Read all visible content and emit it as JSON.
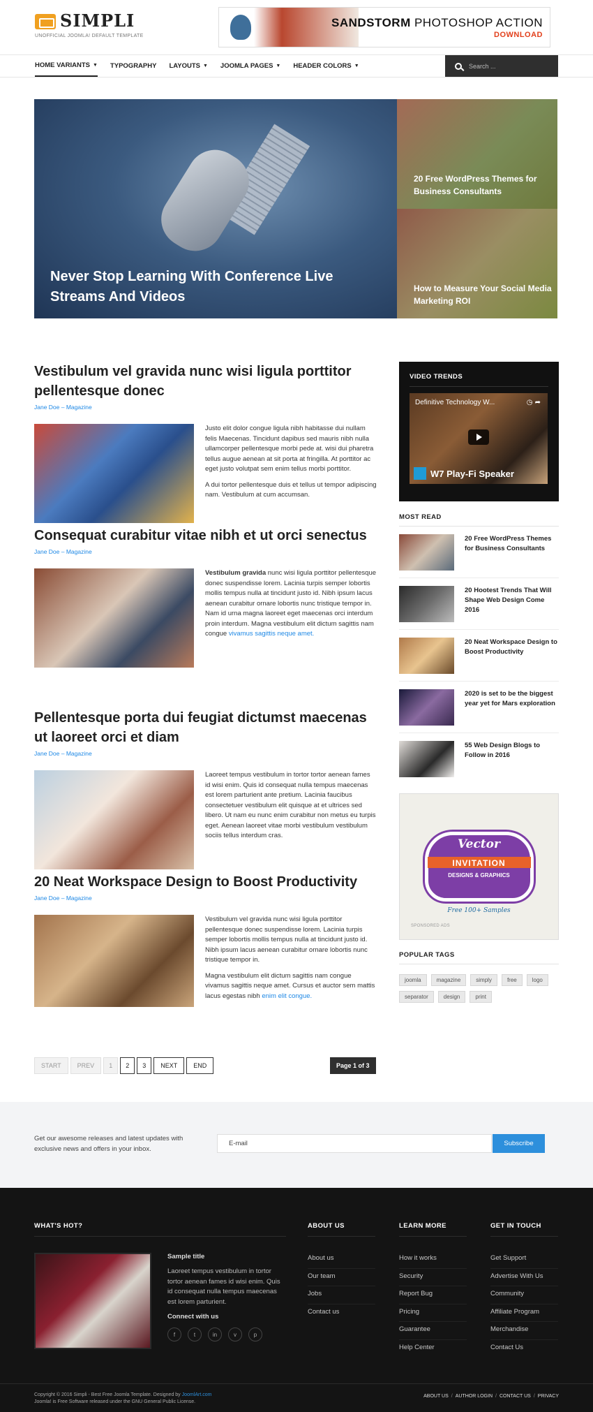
{
  "header": {
    "logo_name": "SIMPLI",
    "logo_tagline": "UNOFFICIAL JOOMLA! DEFAULT TEMPLATE",
    "banner_title_bold": "SANDSTORM",
    "banner_title_rest": " PHOTOSHOP ACTION",
    "banner_cta": "DOWNLOAD"
  },
  "nav": {
    "items": [
      {
        "label": "HOME VARIANTS",
        "caret": true
      },
      {
        "label": "TYPOGRAPHY",
        "caret": false
      },
      {
        "label": "LAYOUTS",
        "caret": true
      },
      {
        "label": "JOOMLA PAGES",
        "caret": true
      },
      {
        "label": "HEADER COLORS",
        "caret": true
      }
    ],
    "search_placeholder": "Search ..."
  },
  "hero": {
    "main_title": "Never Stop Learning With Conference Live Streams And Videos",
    "side": [
      {
        "title": "20 Free WordPress Themes for Business Consultants"
      },
      {
        "title": "How to Measure Your Social Media Marketing ROI"
      }
    ]
  },
  "articles": [
    {
      "title": "Vestibulum vel gravida nunc wisi ligula porttitor pellentesque donec",
      "author": "Jane Doe",
      "category": "Magazine",
      "p1": "Justo elit dolor congue ligula nibh habitasse dui nullam felis Maecenas. Tincidunt dapibus sed mauris nibh nulla ullamcorper pellentesque morbi pede at. wisi dui pharetra tellus augue aenean at sit porta at fringilla. At porttitor ac eget justo volutpat sem enim tellus morbi porttitor.",
      "p2": "A dui tortor pellentesque duis et tellus ut tempor adipiscing nam. Vestibulum at cum accumsan."
    },
    {
      "title": "Consequat curabitur vitae nibh et ut orci senectus",
      "author": "Jane Doe",
      "category": "Magazine",
      "p1_bold": "Vestibulum gravida",
      "p1": " nunc wisi ligula porttitor pellentesque donec suspendisse lorem. Lacinia turpis semper lobortis mollis tempus nulla at tincidunt justo id. Nibh ipsum lacus aenean curabitur ornare lobortis nunc tristique tempor in. Nam id urna magna laoreet eget maecenas orci interdum proin interdum. Magna vestibulum elit dictum sagittis nam congue ",
      "p1_link": "vivamus sagittis neque amet."
    },
    {
      "title": "Pellentesque porta dui feugiat dictumst maecenas ut laoreet orci et diam",
      "author": "Jane Doe",
      "category": "Magazine",
      "p1": "Laoreet tempus vestibulum in tortor tortor aenean fames id wisi enim. Quis id consequat nulla tempus maecenas est lorem parturient ante pretium. Lacinia faucibus consectetuer vestibulum elit quisque at et ultrices sed libero. Ut nam eu nunc enim curabitur non metus eu turpis eget. Aenean laoreet vitae morbi vestibulum vestibulum sociis tellus interdum cras."
    },
    {
      "title": "20 Neat Workspace Design to Boost Productivity",
      "author": "Jane Doe",
      "category": "Magazine",
      "p1": "Vestibulum vel gravida nunc wisi ligula porttitor pellentesque donec suspendisse lorem. Lacinia turpis semper lobortis mollis tempus nulla at tincidunt justo id. Nibh ipsum lacus aenean curabitur ornare lobortis nunc tristique tempor in.",
      "p2": "Magna vestibulum elit dictum sagittis nam congue vivamus sagittis neque amet. Cursus et auctor sem mattis lacus egestas nibh ",
      "p2_link": "enim elit congue."
    }
  ],
  "pagination": {
    "start": "START",
    "prev": "PREV",
    "pages": [
      "1",
      "2",
      "3"
    ],
    "next": "NEXT",
    "end": "END",
    "page_count": "Page 1 of 3"
  },
  "sidebar": {
    "video_title": "VIDEO TRENDS",
    "video_name": "Definitive Technology W...",
    "video_caption": "W7 Play-Fi Speaker",
    "most_read_title": "MOST READ",
    "most_read": [
      "20 Free WordPress Themes for Business Consultants",
      "20 Hootest Trends That Will Shape Web Design Come 2016",
      "20 Neat Workspace Design to Boost Productivity",
      "2020 is set to be the biggest year yet for Mars exploration",
      "55 Web Design Blogs to Follow in 2016"
    ],
    "ad": {
      "vector": "Vector",
      "invitation": "INVITATION",
      "designs": "DESIGNS & GRAPHICS",
      "footer": "Free  100+  Samples",
      "label": "SPONSORED ADS"
    },
    "tags_title": "POPULAR TAGS",
    "tags": [
      "joomla",
      "magazine",
      "simply",
      "free",
      "logo",
      "separator",
      "design",
      "print"
    ]
  },
  "newsletter": {
    "text": "Get our awesome releases and latest updates with exclusive news and offers in your inbox.",
    "placeholder": "E-mail",
    "button": "Subscribe"
  },
  "footer": {
    "hot_title": "WHAT'S HOT?",
    "hot_sample_title": "Sample title",
    "hot_text": "Laoreet tempus vestibulum in tortor tortor aenean fames id wisi enim. Quis id consequat nulla tempus maecenas est lorem parturient.",
    "connect": "Connect with us",
    "socials": [
      "f",
      "t",
      "in",
      "v",
      "p"
    ],
    "columns": [
      {
        "title": "ABOUT US",
        "links": [
          "About us",
          "Our team",
          "Jobs",
          "Contact us"
        ]
      },
      {
        "title": "LEARN MORE",
        "links": [
          "How it works",
          "Security",
          "Report Bug",
          "Pricing",
          "Guarantee",
          "Help Center"
        ]
      },
      {
        "title": "GET IN TOUCH",
        "links": [
          "Get Support",
          "Advertise With Us",
          "Community",
          "Affiliate Program",
          "Merchandise",
          "Contact Us"
        ]
      }
    ],
    "copyright_1": "Copyright © 2016 Simpli - Best Free Joomla Template. Designed by ",
    "copyright_link": "JoomlArt.com",
    "copyright_2": "Joomla! is Free Software released under the GNU General Public License.",
    "bottom_links": [
      "ABOUT US",
      "AUTHOR LOGIN",
      "CONTACT US",
      "PRIVACY"
    ]
  }
}
